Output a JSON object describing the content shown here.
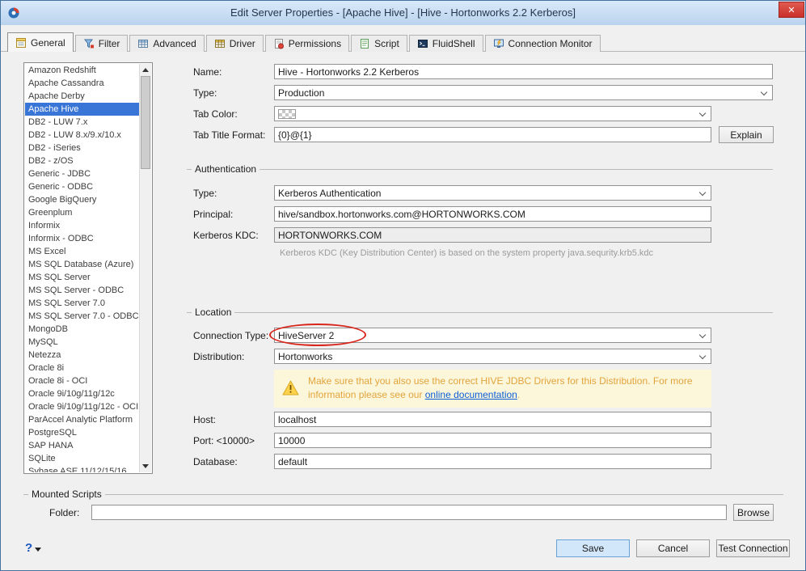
{
  "window": {
    "title": "Edit Server Properties - [Apache Hive] - [Hive - Hortonworks 2.2 Kerberos]",
    "close": "✕"
  },
  "tabs": [
    {
      "label": "General"
    },
    {
      "label": "Filter"
    },
    {
      "label": "Advanced"
    },
    {
      "label": "Driver"
    },
    {
      "label": "Permissions"
    },
    {
      "label": "Script"
    },
    {
      "label": "FluidShell"
    },
    {
      "label": "Connection Monitor"
    }
  ],
  "server_list": {
    "selected": "Apache Hive",
    "items": [
      "Amazon Redshift",
      "Apache Cassandra",
      "Apache Derby",
      "Apache Hive",
      "DB2 - LUW 7.x",
      "DB2 - LUW 8.x/9.x/10.x",
      "DB2 - iSeries",
      "DB2 - z/OS",
      "Generic - JDBC",
      "Generic - ODBC",
      "Google BigQuery",
      "Greenplum",
      "Informix",
      "Informix - ODBC",
      "MS Excel",
      "MS SQL Database (Azure)",
      "MS SQL Server",
      "MS SQL Server - ODBC",
      "MS SQL Server 7.0",
      "MS SQL Server 7.0 - ODBC",
      "MongoDB",
      "MySQL",
      "Netezza",
      "Oracle 8i",
      "Oracle 8i - OCI",
      "Oracle 9i/10g/11g/12c",
      "Oracle 9i/10g/11g/12c - OCI",
      "ParAccel Analytic Platform",
      "PostgreSQL",
      "SAP HANA",
      "SQLite",
      "Sybase ASE 11/12/15/16"
    ]
  },
  "form": {
    "name_label": "Name:",
    "name_value": "Hive - Hortonworks 2.2 Kerberos",
    "type_label": "Type:",
    "type_value": "Production",
    "tab_color_label": "Tab Color:",
    "tab_title_label": "Tab Title Format:",
    "tab_title_value": "{0}@{1}",
    "explain_button": "Explain",
    "auth": {
      "title": "Authentication",
      "type_label": "Type:",
      "type_value": "Kerberos Authentication",
      "principal_label": "Principal:",
      "principal_value": "hive/sandbox.hortonworks.com@HORTONWORKS.COM",
      "kdc_label": "Kerberos KDC:",
      "kdc_value": "HORTONWORKS.COM",
      "note": "Kerberos KDC (Key Distribution Center) is based on the system property java.sequrity.krb5.kdc"
    },
    "location": {
      "title": "Location",
      "connection_type_label": "Connection Type:",
      "connection_type_value": "HiveServer 2",
      "distribution_label": "Distribution:",
      "distribution_value": "Hortonworks",
      "warning_before": "Make sure that you also use the correct HIVE JDBC Drivers for this Distribution. For more information please see our ",
      "warning_link": "online documentation",
      "warning_after": ".",
      "host_label": "Host:",
      "host_value": "localhost",
      "port_label": "Port: <10000>",
      "port_value": "10000",
      "database_label": "Database:",
      "database_value": "default"
    },
    "mounted": {
      "title": "Mounted Scripts",
      "folder_label": "Folder:",
      "folder_value": "",
      "browse_button": "Browse"
    }
  },
  "footer": {
    "save": "Save",
    "cancel": "Cancel",
    "test": "Test Connection",
    "help": "?"
  },
  "colors": {
    "selection": "#3875d6",
    "warning_bg": "#fcf7db",
    "warning_text": "#e2a33c",
    "link": "#0b5ed7",
    "annotation": "#d9261c",
    "save_bg": "#d3e7fa",
    "titlebar": "#b9d3ee"
  }
}
